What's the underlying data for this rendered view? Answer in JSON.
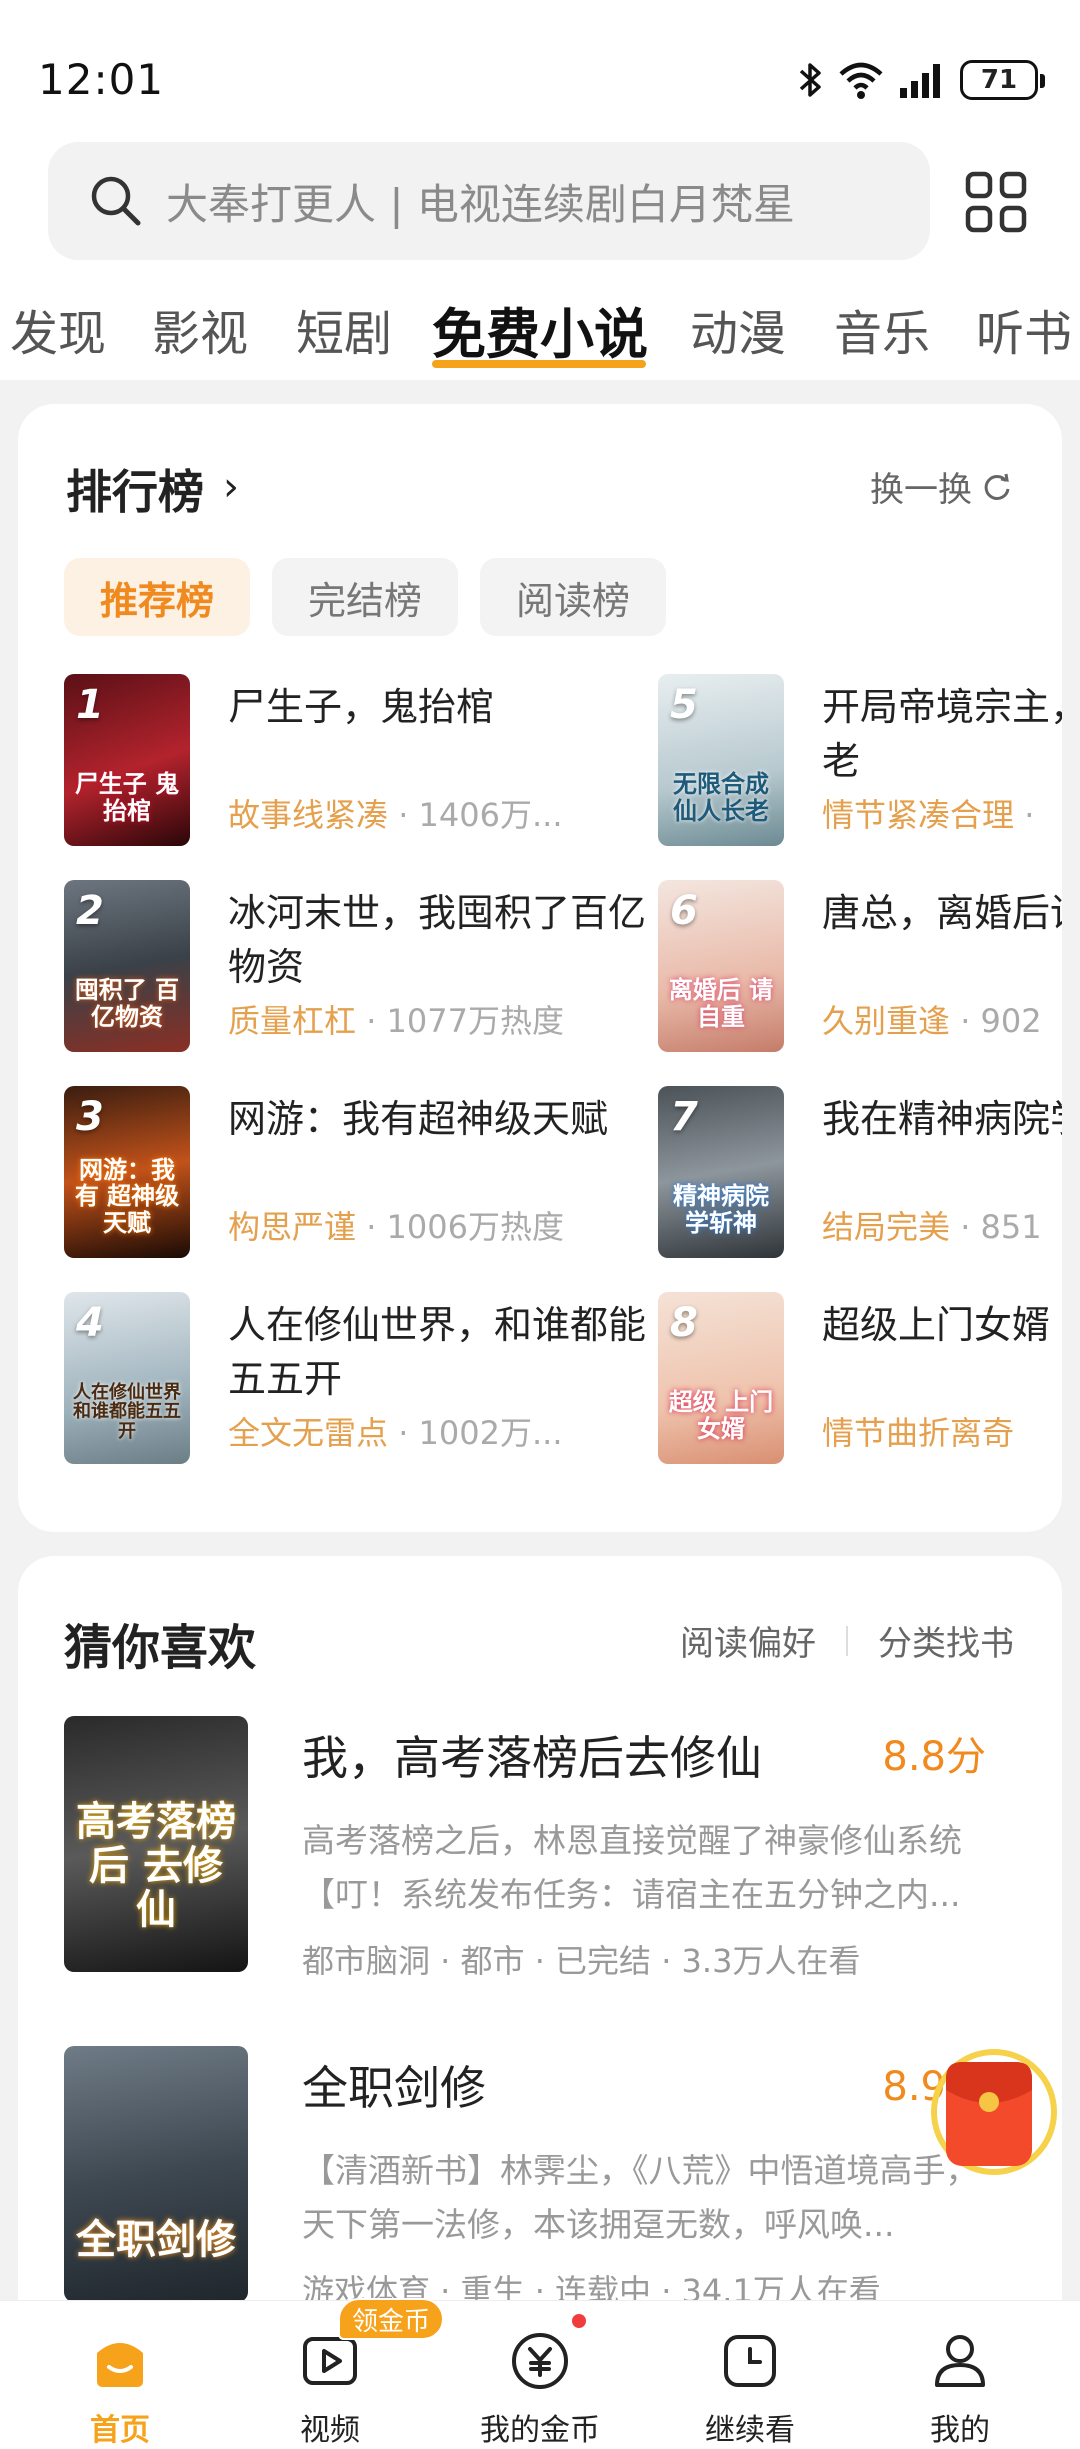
{
  "status_bar": {
    "time": "12:01",
    "battery": "71"
  },
  "search": {
    "placeholder": "大奉打更人 | 电视连续剧白月梵星"
  },
  "tabs": [
    "发现",
    "影视",
    "短剧",
    "免费小说",
    "动漫",
    "音乐",
    "听书"
  ],
  "active_tab": "免费小说",
  "ranking": {
    "title": "排行榜",
    "refresh_label": "换一换",
    "chips": [
      "推荐榜",
      "完结榜",
      "阅读榜"
    ],
    "active_chip": "推荐榜",
    "books": [
      {
        "rank": "1",
        "title": "尸生子，鬼抬棺",
        "tag": "故事线紧凑",
        "heat": "1406万...",
        "cover_text": "尸生子 鬼抬棺"
      },
      {
        "rank": "2",
        "title": "冰河末世，我囤积了百亿物资",
        "tag": "质量杠杠",
        "heat": "1077万热度",
        "cover_text": "囤积了 百亿物资"
      },
      {
        "rank": "3",
        "title": "网游：我有超神级天赋",
        "tag": "构思严谨",
        "heat": "1006万热度",
        "cover_text": "网游：我有 超神级天赋"
      },
      {
        "rank": "4",
        "title": "人在修仙世界，和谁都能五五开",
        "tag": "全文无雷点",
        "heat": "1002万...",
        "cover_text": "人在修仙世界 和谁都能五五开"
      },
      {
        "rank": "5",
        "title": "开局帝境宗主，合成仙人长老",
        "tag": "情节紧凑合理",
        "heat": "",
        "cover_text": "无限合成 仙人长老"
      },
      {
        "rank": "6",
        "title": "唐总，离婚后请自重",
        "tag": "久别重逢",
        "heat": "902",
        "cover_text": "离婚后 请自重"
      },
      {
        "rank": "7",
        "title": "我在精神病院学斩神",
        "tag": "结局完美",
        "heat": "851",
        "cover_text": "精神病院 学斩神"
      },
      {
        "rank": "8",
        "title": "超级上门女婿",
        "tag": "情节曲折离奇",
        "heat": "",
        "cover_text": "超级 上门女婿"
      }
    ]
  },
  "recommend": {
    "title": "猜你喜欢",
    "link_pref": "阅读偏好",
    "link_category": "分类找书",
    "items": [
      {
        "title": "我，高考落榜后去修仙",
        "score": "8.8分",
        "desc": "高考落榜之后，林恩直接觉醒了神豪修仙系统【叮！系统发布任务：请宿主在五分钟之内...",
        "info": "都市脑洞 · 都市 · 已完结 · 3.3万人在看",
        "cover_text": "高考落榜后 去修仙"
      },
      {
        "title": "全职剑修",
        "score": "8.9分",
        "desc": "【清酒新书】林霁尘，《八荒》中悟道境高手，天下第一法修，本该拥趸无数，呼风唤...",
        "info": "游戏体育 · 重生 · 连载中 · 34.1万人在看",
        "cover_text": "全职剑修"
      }
    ]
  },
  "bottom_nav": {
    "items": [
      "首页",
      "视频",
      "我的金币",
      "继续看",
      "我的"
    ],
    "active": "首页",
    "badge": "领金币"
  },
  "colors": {
    "accent": "#f7a21b",
    "tag": "#e5a04e",
    "score": "#f08a1f"
  }
}
